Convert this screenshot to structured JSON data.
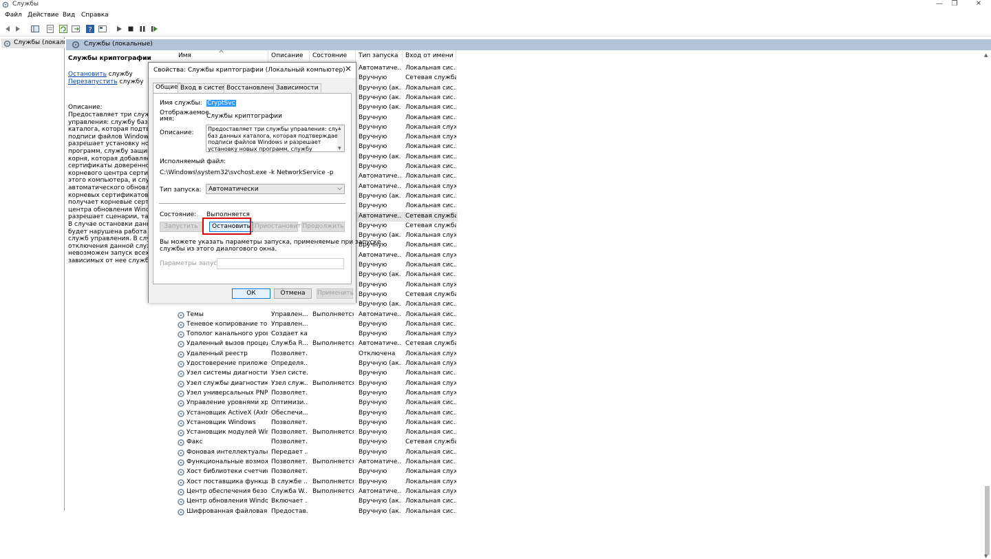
{
  "window": {
    "title": "Службы",
    "controls": [
      "—",
      "❐",
      "✕"
    ]
  },
  "menu": [
    "Файл",
    "Действие",
    "Вид",
    "Справка"
  ],
  "toolbar_icons": [
    "back-icon",
    "forward-icon",
    "console-tree-icon",
    "properties-icon",
    "refresh-icon",
    "export-icon",
    "help-icon",
    "view-icon",
    "play-icon",
    "stop-icon",
    "pause-icon",
    "restart-icon"
  ],
  "tree": {
    "item": "Службы (локальн"
  },
  "header": {
    "title": "Службы (локальные)"
  },
  "left_panel": {
    "service_name": "Службы криптографии",
    "stop_link": "Остановить",
    "stop_suffix": " службу",
    "restart_link": "Перезапустить",
    "restart_suffix": " службу",
    "desc_label": "Описание:",
    "desc_text": "Предоставляет три службы\nуправления: службу баз дан\nкаталога, которая подтверж\nподписи файлов Windows и\nразрешает установку новых\nпрограмм, службу защищ\nкорня, которая добавляет и\nсертификаты доверенного\nкорневого центра сертифик\nэтого компьютера, и службу\nавтоматического обновлен\nкорневых сертификатов, кот\nполучает корневые сертиф\nцентра обновления Window\nразрешает сценарии, такие\nВ случае остановки данной\nбудет нарушена работа всех\nслужб управления. В случае\nотключения данной служб\nневозможен запуск всех явн\nзависимых от нее служб."
  },
  "columns": {
    "name": "Имя",
    "desc": "Описание",
    "state": "Состояние",
    "start": "Тип запуска",
    "login": "Вход от имени"
  },
  "rows": [
    {
      "name": "",
      "desc": "",
      "state": "",
      "start": "Автоматиче...",
      "login": "Локальная сис..."
    },
    {
      "name": "",
      "desc": "",
      "state": "",
      "start": "Вручную",
      "login": "Сетевая служба"
    },
    {
      "name": "",
      "desc": "",
      "state": "",
      "start": "Вручную (ак...",
      "login": "Локальная сис..."
    },
    {
      "name": "",
      "desc": "",
      "state": "",
      "start": "Вручную (ак...",
      "login": "Локальная сис..."
    },
    {
      "name": "",
      "desc": "",
      "state": "",
      "start": "Вручную (ак...",
      "login": "Локальная сис..."
    },
    {
      "name": "",
      "desc": "",
      "state": "",
      "start": "Вручную",
      "login": "Локальная сис..."
    },
    {
      "name": "",
      "desc": "",
      "state": "",
      "start": "Вручную",
      "login": "Локальная служба"
    },
    {
      "name": "",
      "desc": "",
      "state": "",
      "start": "Вручную",
      "login": "Локальная служба"
    },
    {
      "name": "",
      "desc": "",
      "state": "",
      "start": "Вручную",
      "login": "Локальная сис..."
    },
    {
      "name": "",
      "desc": "",
      "state": "",
      "start": "Вручную (ак...",
      "login": "Локальная сис..."
    },
    {
      "name": "",
      "desc": "",
      "state": "",
      "start": "Вручную",
      "login": "Локальная сис..."
    },
    {
      "name": "",
      "desc": "",
      "state": "",
      "start": "Автоматиче...",
      "login": "Локальная сис..."
    },
    {
      "name": "",
      "desc": "",
      "state": "",
      "start": "Автоматиче...",
      "login": "Локальная служба"
    },
    {
      "name": "",
      "desc": "",
      "state": "",
      "start": "Вручную (ак...",
      "login": "Локальная сис..."
    },
    {
      "name": "",
      "desc": "",
      "state": "",
      "start": "Вручную",
      "login": "Локальная сис..."
    },
    {
      "name": "",
      "desc": "",
      "state": "",
      "start": "Автоматиче...",
      "login": "Сетевая служба",
      "selected": true
    },
    {
      "name": "",
      "desc": "",
      "state": "",
      "start": "Вручную",
      "login": "Сетевая служба"
    },
    {
      "name": "",
      "desc": "",
      "state": "",
      "start": "Вручную (ак...",
      "login": "Локальная служба"
    },
    {
      "name": "",
      "desc": "",
      "state": "",
      "start": "Вручную",
      "login": "Локальная сис..."
    },
    {
      "name": "",
      "desc": "",
      "state": "",
      "start": "Автоматиче...",
      "login": "Локальная служба"
    },
    {
      "name": "",
      "desc": "",
      "state": "",
      "start": "Вручную",
      "login": "Локальная сис..."
    },
    {
      "name": "",
      "desc": "",
      "state": "",
      "start": "Вручную (ак...",
      "login": "Локальная сис..."
    },
    {
      "name": "",
      "desc": "",
      "state": "",
      "start": "Вручную",
      "login": "Локальная служба"
    },
    {
      "name": "",
      "desc": "",
      "state": "",
      "start": "Вручную",
      "login": "Сетевая служба"
    },
    {
      "name": "",
      "desc": "",
      "state": "",
      "start": "Вручную (ак...",
      "login": "Локальная сис..."
    },
    {
      "name": "Темы",
      "desc": "Управлен...",
      "state": "Выполняется",
      "start": "Автоматиче...",
      "login": "Локальная сис..."
    },
    {
      "name": "Теневое копирование тома",
      "desc": "Управлен...",
      "state": "",
      "start": "Вручную",
      "login": "Локальная сис..."
    },
    {
      "name": "Тополог канального уровня",
      "desc": "Создает ка...",
      "state": "",
      "start": "Вручную",
      "login": "Локальная служба"
    },
    {
      "name": "Удаленный вызов процеду...",
      "desc": "Служба R...",
      "state": "Выполняется",
      "start": "Автоматиче...",
      "login": "Сетевая служба"
    },
    {
      "name": "Удаленный реестр",
      "desc": "Позволяет...",
      "state": "",
      "start": "Отключена",
      "login": "Локальная служба"
    },
    {
      "name": "Удостоверение приложения",
      "desc": "Определя...",
      "state": "",
      "start": "Вручную (ак...",
      "login": "Локальная служба"
    },
    {
      "name": "Узел системы диагностики",
      "desc": "Узел систе...",
      "state": "",
      "start": "Вручную",
      "login": "Локальная сис..."
    },
    {
      "name": "Узел службы диагностики",
      "desc": "Узел служ...",
      "state": "Выполняется",
      "start": "Вручную",
      "login": "Локальная служба"
    },
    {
      "name": "Узел универсальных PNP-...",
      "desc": "Позволяет...",
      "state": "",
      "start": "Вручную",
      "login": "Локальная служба"
    },
    {
      "name": "Управление уровнями хра...",
      "desc": "Оптимизи...",
      "state": "",
      "start": "Вручную",
      "login": "Локальная сис..."
    },
    {
      "name": "Установщик ActiveX (AxIns...",
      "desc": "Обеспечи...",
      "state": "",
      "start": "Вручную",
      "login": "Локальная сис..."
    },
    {
      "name": "Установщик Windows",
      "desc": "Позволяет...",
      "state": "",
      "start": "Вручную",
      "login": "Локальная сис..."
    },
    {
      "name": "Установщик модулей Win...",
      "desc": "Позволяет...",
      "state": "Выполняется",
      "start": "Вручную",
      "login": "Локальная сис..."
    },
    {
      "name": "Факс",
      "desc": "Позволяет...",
      "state": "",
      "start": "Вручную",
      "login": "Сетевая служба"
    },
    {
      "name": "Фоновая интеллектуальна...",
      "desc": "Передает ...",
      "state": "",
      "start": "Вручную",
      "login": "Локальная сис..."
    },
    {
      "name": "Функциональные возмож...",
      "desc": "Позволяет...",
      "state": "Выполняется",
      "start": "Автоматиче...",
      "login": "Локальная сис..."
    },
    {
      "name": "Хост библиотеки счетчика...",
      "desc": "Позволяет...",
      "state": "",
      "start": "Вручную",
      "login": "Локальная служба"
    },
    {
      "name": "Хост поставщика функци...",
      "desc": "В службе ...",
      "state": "Выполняется",
      "start": "Вручную",
      "login": "Локальная служба"
    },
    {
      "name": "Центр обеспечения безоп...",
      "desc": "Служба W...",
      "state": "Выполняется",
      "start": "Автоматиче...",
      "login": "Локальная служба"
    },
    {
      "name": "Центр обновления Windows",
      "desc": "Включает ...",
      "state": "",
      "start": "Вручную (ак...",
      "login": "Локальная сис..."
    },
    {
      "name": "Шифрованная файловая с...",
      "desc": "Предостав...",
      "state": "",
      "start": "Вручную (ак...",
      "login": "Локальная сис..."
    }
  ],
  "dialog": {
    "title": "Свойства: Службы криптографии (Локальный компьютер)",
    "tabs": [
      "Общие",
      "Вход в систему",
      "Восстановление",
      "Зависимости"
    ],
    "service_name_label": "Имя службы:",
    "service_name_value": "CryptSvc",
    "display_name_label": "Отображаемое\nимя:",
    "display_name_value": "Службы криптографии",
    "description_label": "Описание:",
    "description_value": "Предоставляет три службы управления: службу\nбаз данных каталога, которая подтверждает\nподписи файлов Windows и разрешает\nустановку новых программ, службу",
    "exe_label": "Исполняемый файл:",
    "exe_value": "C:\\Windows\\system32\\svchost.exe -k NetworkService -p",
    "startup_label": "Тип запуска:",
    "startup_value": "Автоматически",
    "state_label": "Состояние:",
    "state_value": "Выполняется",
    "btn_start": "Запустить",
    "btn_stop": "Остановить",
    "btn_pause": "Приостановить",
    "btn_resume": "Продолжить",
    "hint": "Вы можете указать параметры запуска, применяемые при запуске\nслужбы из этого диалогового окна.",
    "params_label": "Параметры запуска:",
    "params_value": "",
    "ok": "ОК",
    "cancel": "Отмена",
    "apply": "Применить"
  },
  "colors": {
    "accent": "#0078d7",
    "highlight": "#e00000",
    "header_band": "#b3c3d9"
  }
}
